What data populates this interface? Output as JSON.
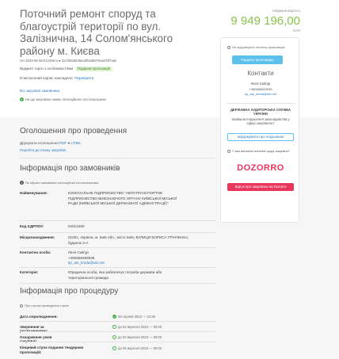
{
  "tender": {
    "title": "Поточний ремонт споруд та благоустрій території по вул. Залізнична, 14 Солом'янського району м. Києва",
    "id": "UA-2023-08-28-012359-a",
    "hash": "31ef39ab0d5ea0f0ad8076ae0f3f7ade",
    "procedure_label": "Відкриті торги з особливостями",
    "status_badge": "Подання пропозицій",
    "signature_text": "Електронний підпис накладено.",
    "signature_link": "Перевірити",
    "all_procurements_link": "Всі закупівлі замовника",
    "no_prior_notice": "На цю закупівлю немає потенційного постачальника"
  },
  "price": {
    "caption": "очікувана вартість",
    "amount": "9 949 196,00",
    "currency": "UAH"
  },
  "panel": {
    "notice_text": "Не підтримуєте поточну пропозицію",
    "submit_button": "Подати пропозицію",
    "contacts_title": "Контакти",
    "contact_name": "Леся Сміґур",
    "contact_phone": "+380668383939",
    "contact_email": "kp_ats_kmda@ukr.net",
    "audit_title": "ДЕРЖАВНА АУДИТОРСЬКА СЛУЖБА УКРАЇНИ",
    "audit_text": "Знайшли порушення законодавства у сфері закупівель?",
    "audit_button": "Інформувати про порушення",
    "dozorro_note": "У вас виникли питання щодо закупівлі?",
    "dozorro_logo": "DOZORRO",
    "dozorro_button": "Відгук про закупівлю на Dozorro"
  },
  "announcement": {
    "title": "Оголошення про проведення",
    "print_label": "Друкувати оголошення",
    "print_pdf": "PDF",
    "print_html": "HTML",
    "plan_link": "Перейти до плану закупівлі"
  },
  "customer": {
    "title": "Інформація про замовників",
    "note": "Як обрати замовника потенційних постачальників",
    "rows": [
      {
        "label": "Найменування:",
        "value": "КОМУНАЛЬНЕ ПІДПРИЄМСТВО \"АВТОТРАНСПОРТНЕ ПІДПРИЄМСТВО ВИКОНАВЧОГО ОРГАНУ КИЇВСЬКОЇ МІСЬКОЇ РАДИ (КИЇВСЬКОЇ МІСЬКОЇ ДЕРЖАВНОЇ АДМІНІСТРАЦІЇ)\""
      },
      {
        "label": "Код ЄДРПОУ:",
        "value": "04012460"
      },
      {
        "label": "Місцезнаходження:",
        "value": "01001, Україна, м. Київ обл., місто Київ, ВУЛИЦЯ БОРИСА ГРІНЧЕНКА, будинок 3-А"
      },
      {
        "label": "Контактна особа:",
        "value": "Леся Сміґур"
      },
      {
        "label": "Категорія:",
        "value": "Юридична особа, яка забезпечує потреби держави або територіальної громади"
      }
    ],
    "contact_phone": "+380668383939",
    "contact_email": "kp_ats_kmda@ukr.net"
  },
  "procedure": {
    "title": "Інформація про процедуру",
    "note": "Про строки проведення торгів",
    "rows": [
      {
        "label": "Дата оприлюднення:",
        "value": "28 серпня 2023 — 22:36"
      },
      {
        "label": "Звернення за роз'ясненнями:",
        "value": "до 02 вересня 2023 — 00:00"
      },
      {
        "label": "Оскарження умов закупівлі:",
        "value": "до 02 вересня 2023 — 00:00"
      },
      {
        "label": "Кінцевий строк подання тендерних пропозицій:",
        "value": "до 05 вересня 2023 — 00:00"
      }
    ]
  },
  "colors": {
    "accent_green": "#8bc34a",
    "accent_blue": "#5bc0eb",
    "dozorro_pink": "#e8365d"
  }
}
